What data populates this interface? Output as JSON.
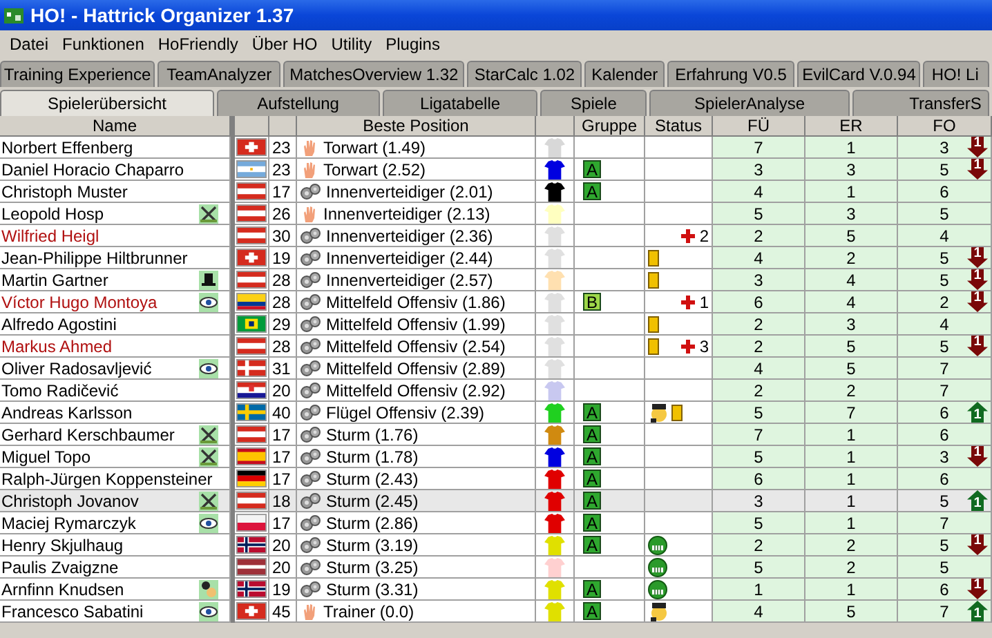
{
  "window": {
    "title": "HO! - Hattrick Organizer 1.37"
  },
  "menu": [
    "Datei",
    "Funktionen",
    "HoFriendly",
    "Über HO",
    "Utility",
    "Plugins"
  ],
  "plugin_tabs": [
    {
      "label": "Training Experience",
      "selected": false
    },
    {
      "label": "TeamAnalyzer",
      "selected": false
    },
    {
      "label": "MatchesOverview 1.32",
      "selected": false
    },
    {
      "label": "StarCalc 1.02",
      "selected": false
    },
    {
      "label": "Kalender",
      "selected": false
    },
    {
      "label": "Erfahrung V0.5",
      "selected": false
    },
    {
      "label": "EvilCard V.0.94",
      "selected": false
    },
    {
      "label": "HO! Li",
      "selected": false
    }
  ],
  "main_tabs": [
    {
      "label": "Spielerübersicht",
      "selected": true
    },
    {
      "label": "Aufstellung",
      "selected": false
    },
    {
      "label": "Ligatabelle",
      "selected": false
    },
    {
      "label": "Spiele",
      "selected": false
    },
    {
      "label": "SpielerAnalyse",
      "selected": false
    },
    {
      "label": "TransferS",
      "selected": false
    }
  ],
  "table": {
    "columns": {
      "name": "Name",
      "position": "Beste Position",
      "group": "Gruppe",
      "status": "Status",
      "fu": "FÜ",
      "er": "ER",
      "fo": "FO"
    },
    "rows": [
      {
        "name": "Norbert Effenberg",
        "selected": false,
        "flag": {
          "kind": "swiss"
        },
        "age": "23",
        "pos_icon": {
          "kind": "hand"
        },
        "position": "Torwart (1.49)",
        "shirt": {
          "color": "#d8d8d8"
        },
        "card": false,
        "fu": "7",
        "er": "1",
        "fo": "3",
        "trend": {
          "kind": "down",
          "text": "1"
        }
      },
      {
        "name": "Daniel Horacio Chaparro",
        "selected": false,
        "flag": {
          "kind": "argentina"
        },
        "age": "23",
        "pos_icon": {
          "kind": "hand"
        },
        "position": "Torwart (2.52)",
        "shirt": {
          "color": "#0000e0"
        },
        "group": {
          "label": "A",
          "color": "#2fa82f"
        },
        "card": false,
        "fu": "3",
        "er": "3",
        "fo": "5",
        "trend": {
          "kind": "down",
          "text": "1"
        }
      },
      {
        "name": "Christoph Muster",
        "selected": false,
        "flag": {
          "kind": "austria"
        },
        "age": "17",
        "pos_icon": {
          "kind": "gears"
        },
        "position": "Innenverteidiger (2.01)",
        "shirt": {
          "color": "#000000"
        },
        "group": {
          "label": "A",
          "color": "#2fa82f"
        },
        "card": false,
        "fu": "4",
        "er": "1",
        "fo": "6"
      },
      {
        "name": "Leopold Hosp",
        "selected": false,
        "note": {
          "kind": "crossed"
        },
        "flag": {
          "kind": "austria"
        },
        "age": "26",
        "pos_icon": {
          "kind": "hand"
        },
        "position": "Innenverteidiger (2.13)",
        "shirt": {
          "color": "#ffffc0"
        },
        "card": false,
        "fu": "5",
        "er": "3",
        "fo": "5"
      },
      {
        "name": "Wilfried Heigl",
        "selected": false,
        "flag": {
          "kind": "austria"
        },
        "age": "30",
        "pos_icon": {
          "kind": "gears"
        },
        "position": "Innenverteidiger (2.36)",
        "shirt": {
          "color": "#e0e0e0"
        },
        "card": false,
        "injury": "2",
        "fu": "2",
        "er": "5",
        "fo": "4"
      },
      {
        "name": "Jean-Philippe Hiltbrunner",
        "selected": false,
        "flag": {
          "kind": "swiss"
        },
        "age": "19",
        "pos_icon": {
          "kind": "gears"
        },
        "position": "Innenverteidiger (2.44)",
        "shirt": {
          "color": "#e0e0e0"
        },
        "card": true,
        "fu": "4",
        "er": "2",
        "fo": "5",
        "trend": {
          "kind": "down",
          "text": "1"
        }
      },
      {
        "name": "Martin Gartner",
        "selected": false,
        "note": {
          "kind": "hat"
        },
        "flag": {
          "kind": "austria"
        },
        "age": "28",
        "pos_icon": {
          "kind": "gears"
        },
        "position": "Innenverteidiger (2.57)",
        "shirt": {
          "color": "#ffe0b0"
        },
        "card": true,
        "fu": "3",
        "er": "4",
        "fo": "5",
        "trend": {
          "kind": "down",
          "text": "1"
        }
      },
      {
        "name": "Víctor Hugo Montoya",
        "selected": false,
        "note": {
          "kind": "eye"
        },
        "flag": {
          "kind": "colombia"
        },
        "age": "28",
        "pos_icon": {
          "kind": "gears"
        },
        "position": "Mittelfeld Offensiv (1.86)",
        "shirt": {
          "color": "#e0e0e0"
        },
        "group": {
          "label": "B",
          "color": "#9ed84a"
        },
        "card": false,
        "injury": "1",
        "fu": "6",
        "er": "4",
        "fo": "2",
        "trend": {
          "kind": "down",
          "text": "1"
        }
      },
      {
        "name": "Alfredo Agostini",
        "selected": false,
        "flag": {
          "kind": "brazil"
        },
        "age": "29",
        "pos_icon": {
          "kind": "gears"
        },
        "position": "Mittelfeld Offensiv (1.99)",
        "shirt": {
          "color": "#e0e0e0"
        },
        "card": true,
        "fu": "2",
        "er": "3",
        "fo": "4"
      },
      {
        "name": "Markus Ahmed",
        "selected": false,
        "flag": {
          "kind": "austria"
        },
        "age": "28",
        "pos_icon": {
          "kind": "gears"
        },
        "position": "Mittelfeld Offensiv (2.54)",
        "shirt": {
          "color": "#e0e0e0"
        },
        "card": true,
        "injury": "3",
        "fu": "2",
        "er": "5",
        "fo": "5",
        "trend": {
          "kind": "down",
          "text": "1"
        }
      },
      {
        "name": "Oliver Radosavljević",
        "selected": false,
        "note": {
          "kind": "eye"
        },
        "flag": {
          "kind": "denmark"
        },
        "age": "31",
        "pos_icon": {
          "kind": "gears"
        },
        "position": "Mittelfeld Offensiv (2.89)",
        "shirt": {
          "color": "#e0e0e0"
        },
        "card": false,
        "fu": "4",
        "er": "5",
        "fo": "7"
      },
      {
        "name": "Tomo Radičević",
        "selected": false,
        "flag": {
          "kind": "croatia"
        },
        "age": "20",
        "pos_icon": {
          "kind": "gears"
        },
        "position": "Mittelfeld Offensiv (2.92)",
        "shirt": {
          "color": "#c8c8f0"
        },
        "card": false,
        "fu": "2",
        "er": "2",
        "fo": "7"
      },
      {
        "name": "Andreas Karlsson",
        "selected": false,
        "flag": {
          "kind": "sweden"
        },
        "age": "40",
        "pos_icon": {
          "kind": "gears"
        },
        "position": "Flügel Offensiv (2.39)",
        "shirt": {
          "color": "#20d020"
        },
        "group": {
          "label": "A",
          "color": "#2fa82f"
        },
        "mood": {
          "kind": "cap-face"
        },
        "card": true,
        "fu": "5",
        "er": "7",
        "fo": "6",
        "trend": {
          "kind": "up",
          "text": "1"
        }
      },
      {
        "name": "Gerhard Kerschbaumer",
        "selected": false,
        "note": {
          "kind": "crossed"
        },
        "flag": {
          "kind": "austria"
        },
        "age": "17",
        "pos_icon": {
          "kind": "gears"
        },
        "position": "Sturm (1.76)",
        "shirt": {
          "color": "#d08a10"
        },
        "group": {
          "label": "A",
          "color": "#2fa82f"
        },
        "card": false,
        "fu": "7",
        "er": "1",
        "fo": "6"
      },
      {
        "name": "Miguel Topo",
        "selected": false,
        "note": {
          "kind": "crossed"
        },
        "flag": {
          "kind": "spain"
        },
        "age": "17",
        "pos_icon": {
          "kind": "gears"
        },
        "position": "Sturm (1.78)",
        "shirt": {
          "color": "#0000e0"
        },
        "group": {
          "label": "A",
          "color": "#2fa82f"
        },
        "card": false,
        "fu": "5",
        "er": "1",
        "fo": "3",
        "trend": {
          "kind": "down",
          "text": "1"
        }
      },
      {
        "name": "Ralph-Jürgen Koppensteiner",
        "selected": false,
        "flag": {
          "kind": "germany"
        },
        "age": "17",
        "pos_icon": {
          "kind": "gears"
        },
        "position": "Sturm (2.43)",
        "shirt": {
          "color": "#e00000"
        },
        "group": {
          "label": "A",
          "color": "#2fa82f"
        },
        "card": false,
        "fu": "6",
        "er": "1",
        "fo": "6"
      },
      {
        "name": "Christoph Jovanov",
        "selected": true,
        "note": {
          "kind": "crossed"
        },
        "flag": {
          "kind": "austria"
        },
        "age": "18",
        "pos_icon": {
          "kind": "gears"
        },
        "position": "Sturm (2.45)",
        "shirt": {
          "color": "#e00000"
        },
        "group": {
          "label": "A",
          "color": "#2fa82f"
        },
        "card": false,
        "fu": "3",
        "er": "1",
        "fo": "5",
        "trend": {
          "kind": "up",
          "text": "1"
        }
      },
      {
        "name": "Maciej Rymarczyk",
        "selected": false,
        "note": {
          "kind": "eye"
        },
        "flag": {
          "kind": "poland"
        },
        "age": "17",
        "pos_icon": {
          "kind": "gears"
        },
        "position": "Sturm (2.86)",
        "shirt": {
          "color": "#e00000"
        },
        "group": {
          "label": "A",
          "color": "#2fa82f"
        },
        "card": false,
        "fu": "5",
        "er": "1",
        "fo": "7"
      },
      {
        "name": "Henry Skjulhaug",
        "selected": false,
        "flag": {
          "kind": "norway"
        },
        "age": "20",
        "pos_icon": {
          "kind": "gears"
        },
        "position": "Sturm (3.19)",
        "shirt": {
          "color": "#e0e000"
        },
        "group": {
          "label": "A",
          "color": "#2fa82f"
        },
        "mood": {
          "kind": "grin"
        },
        "card": false,
        "fu": "2",
        "er": "2",
        "fo": "5",
        "trend": {
          "kind": "down",
          "text": "1"
        }
      },
      {
        "name": "Paulis Zvaigzne",
        "selected": false,
        "flag": {
          "kind": "latvia"
        },
        "age": "20",
        "pos_icon": {
          "kind": "gears"
        },
        "position": "Sturm (3.25)",
        "shirt": {
          "color": "#ffd0d0"
        },
        "mood": {
          "kind": "grin"
        },
        "card": false,
        "fu": "5",
        "er": "2",
        "fo": "5"
      },
      {
        "name": "Arnfinn Knudsen",
        "selected": false,
        "note": {
          "kind": "player"
        },
        "flag": {
          "kind": "norway"
        },
        "age": "19",
        "pos_icon": {
          "kind": "gears"
        },
        "position": "Sturm (3.31)",
        "shirt": {
          "color": "#e0e000"
        },
        "group": {
          "label": "A",
          "color": "#2fa82f"
        },
        "mood": {
          "kind": "grin"
        },
        "card": false,
        "fu": "1",
        "er": "1",
        "fo": "6",
        "trend": {
          "kind": "down",
          "text": "1"
        }
      },
      {
        "name": "Francesco Sabatini",
        "selected": false,
        "note": {
          "kind": "eye"
        },
        "flag": {
          "kind": "swiss"
        },
        "age": "45",
        "pos_icon": {
          "kind": "hand"
        },
        "position": "Trainer (0.0)",
        "shirt": {
          "color": "#e0e000"
        },
        "group": {
          "label": "A",
          "color": "#2fa82f"
        },
        "mood": {
          "kind": "cap-face"
        },
        "card": false,
        "fu": "4",
        "er": "5",
        "fo": "7",
        "trend": {
          "kind": "up",
          "text": "1"
        }
      }
    ]
  }
}
